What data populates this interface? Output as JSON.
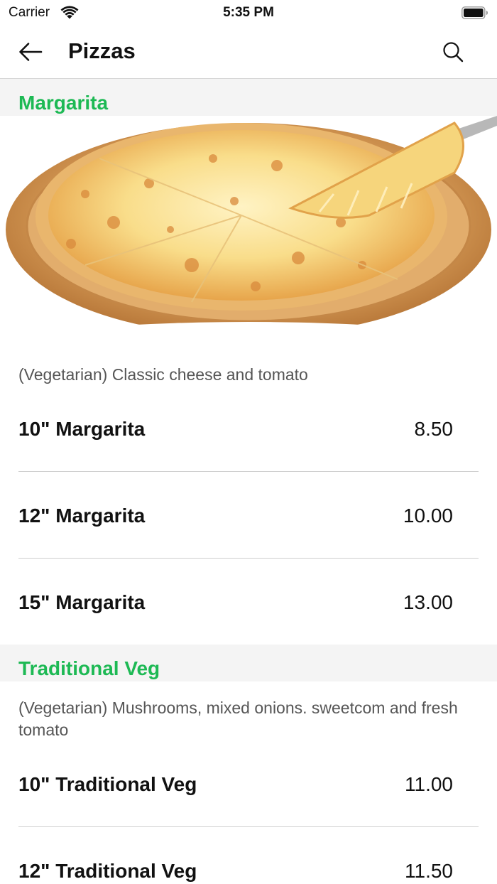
{
  "status_bar": {
    "carrier": "Carrier",
    "time": "5:35 PM"
  },
  "nav": {
    "title": "Pizzas",
    "back_icon": "arrow-left-icon",
    "search_icon": "search-icon"
  },
  "colors": {
    "accent": "#1db954",
    "section_bg": "#f4f4f4"
  },
  "sections": [
    {
      "title": "Margarita",
      "description": "(Vegetarian) Classic cheese and tomato",
      "items": [
        {
          "name": "10\" Margarita",
          "price": "8.50"
        },
        {
          "name": "12\" Margarita",
          "price": "10.00"
        },
        {
          "name": "15\" Margarita",
          "price": "13.00"
        }
      ]
    },
    {
      "title": "Traditional Veg",
      "description": "(Vegetarian) Mushrooms, mixed onions. sweetcom and fresh tomato",
      "items": [
        {
          "name": "10\" Traditional Veg",
          "price": "11.00"
        },
        {
          "name": "12\" Traditional Veg",
          "price": "11.50"
        }
      ]
    }
  ]
}
